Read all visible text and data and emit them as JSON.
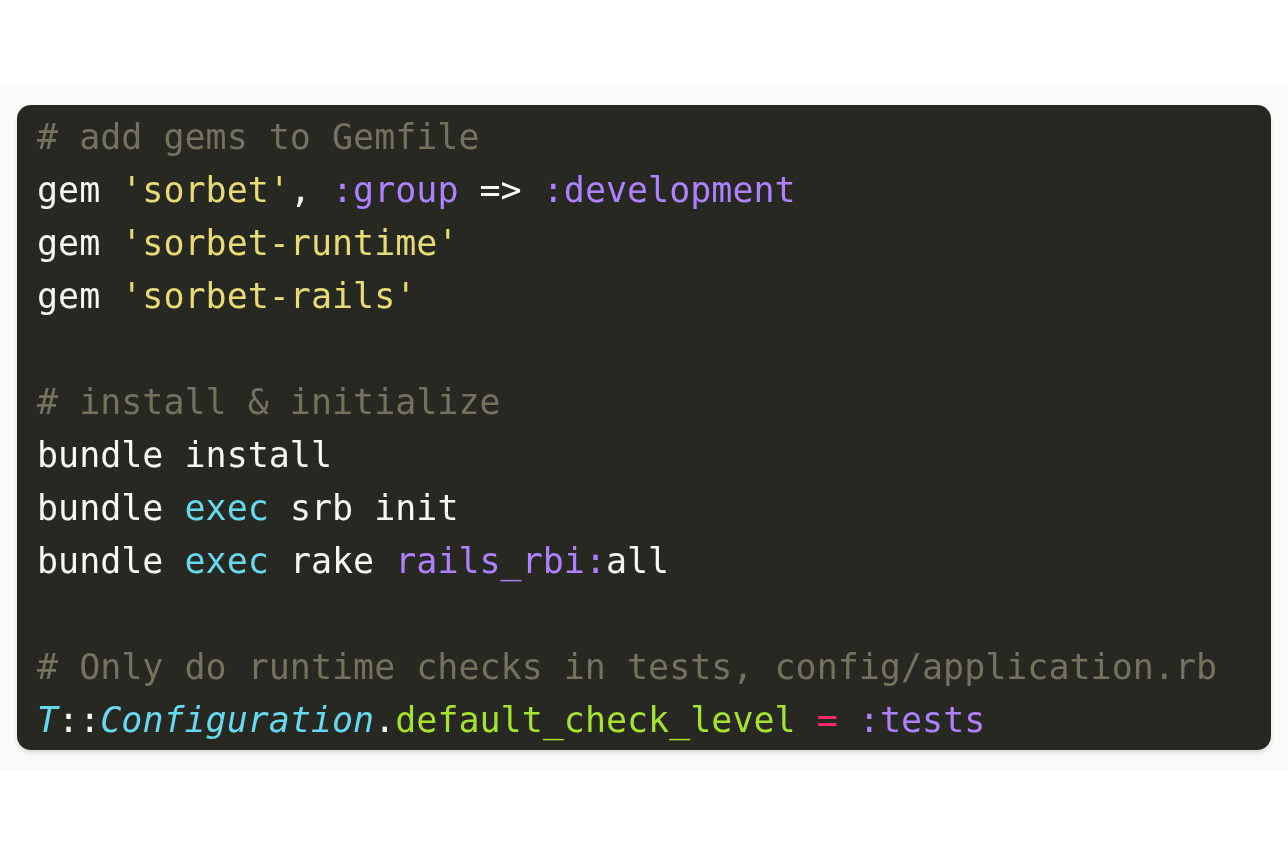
{
  "code_lines": [
    {
      "kind": "code",
      "tokens": [
        {
          "kind": "comment",
          "text": "# add gems to Gemfile"
        }
      ]
    },
    {
      "kind": "code",
      "tokens": [
        {
          "kind": "plain",
          "text": "gem "
        },
        {
          "kind": "string",
          "text": "'sorbet'"
        },
        {
          "kind": "plain",
          "text": ", "
        },
        {
          "kind": "symbol",
          "text": ":group"
        },
        {
          "kind": "plain",
          "text": " => "
        },
        {
          "kind": "symbol",
          "text": ":development"
        }
      ]
    },
    {
      "kind": "code",
      "tokens": [
        {
          "kind": "plain",
          "text": "gem "
        },
        {
          "kind": "string",
          "text": "'sorbet-runtime'"
        }
      ]
    },
    {
      "kind": "code",
      "tokens": [
        {
          "kind": "plain",
          "text": "gem "
        },
        {
          "kind": "string",
          "text": "'sorbet-rails'"
        }
      ]
    },
    {
      "kind": "blank"
    },
    {
      "kind": "code",
      "tokens": [
        {
          "kind": "comment",
          "text": "# install & initialize"
        }
      ]
    },
    {
      "kind": "code",
      "tokens": [
        {
          "kind": "plain",
          "text": "bundle install"
        }
      ]
    },
    {
      "kind": "code",
      "tokens": [
        {
          "kind": "plain",
          "text": "bundle "
        },
        {
          "kind": "keyword",
          "text": "exec"
        },
        {
          "kind": "plain",
          "text": " srb init"
        }
      ]
    },
    {
      "kind": "code",
      "tokens": [
        {
          "kind": "plain",
          "text": "bundle "
        },
        {
          "kind": "keyword",
          "text": "exec"
        },
        {
          "kind": "plain",
          "text": " rake "
        },
        {
          "kind": "symbol",
          "text": "rails_rbi:"
        },
        {
          "kind": "plain",
          "text": "all"
        }
      ]
    },
    {
      "kind": "blank"
    },
    {
      "kind": "code",
      "tokens": [
        {
          "kind": "comment",
          "text": "# Only do runtime checks in tests, config/application.rb"
        }
      ]
    },
    {
      "kind": "code",
      "tokens": [
        {
          "kind": "class",
          "text": "T"
        },
        {
          "kind": "plain",
          "text": "::"
        },
        {
          "kind": "class",
          "text": "Configuration"
        },
        {
          "kind": "plain",
          "text": "."
        },
        {
          "kind": "method",
          "text": "default_check_level"
        },
        {
          "kind": "operator",
          "text": " = "
        },
        {
          "kind": "symbol",
          "text": ":tests"
        }
      ]
    }
  ]
}
